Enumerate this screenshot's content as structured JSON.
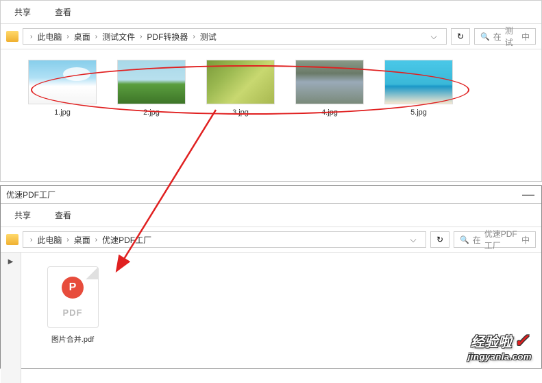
{
  "top": {
    "tabs": {
      "share": "共享",
      "view": "查看"
    },
    "breadcrumb": [
      "此电脑",
      "桌面",
      "测试文件",
      "PDF转换器",
      "测试"
    ],
    "search_prefix": "在",
    "search_context": "测试",
    "search_suffix": "中",
    "files": [
      {
        "name": "1.jpg"
      },
      {
        "name": "2.jpg"
      },
      {
        "name": "3.jpg"
      },
      {
        "name": "4.jpg"
      },
      {
        "name": "5.jpg"
      }
    ]
  },
  "bottom": {
    "title": "优速PDF工厂",
    "tabs": {
      "share": "共享",
      "view": "查看"
    },
    "breadcrumb": [
      "此电脑",
      "桌面",
      "优速PDF工厂"
    ],
    "search_prefix": "在",
    "search_context": "优速PDF工厂",
    "search_suffix": "中",
    "pdf_badge": "P",
    "pdf_type": "PDF",
    "pdf_name": "图片合并.pdf"
  },
  "watermark": {
    "top": "经验啦",
    "check": "✓",
    "bottom": "jingyanla.com"
  },
  "icons": {
    "sep": "›",
    "down": "⌵",
    "refresh": "↻",
    "search": "🔍",
    "min": "—",
    "chev": "▶"
  }
}
